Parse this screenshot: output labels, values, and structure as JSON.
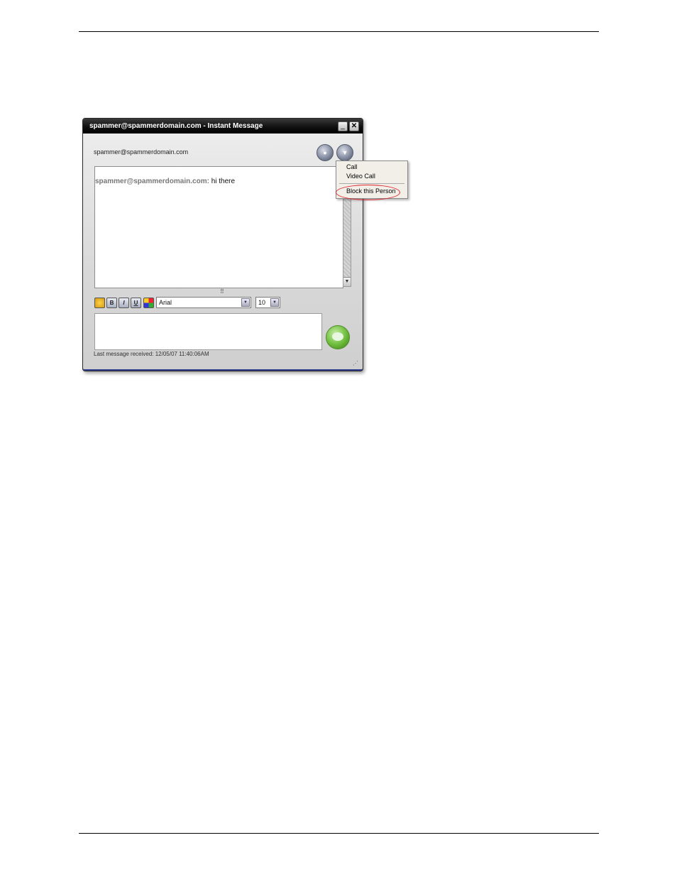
{
  "window": {
    "title": "spammer@spammerdomain.com - Instant Message",
    "minimize_glyph": "_",
    "close_glyph": "✕"
  },
  "header": {
    "contact": "spammer@spammerdomain.com",
    "contact_button_icon": "contact-icon",
    "menu_button_icon": "chevron-down-icon"
  },
  "chat": {
    "sender": "spammer@spammerdomain.com:",
    "message": " hi there"
  },
  "toolbar": {
    "bold_label": "B",
    "italic_label": "I",
    "underline_label": "U",
    "font": "Arial",
    "size": "10"
  },
  "status": {
    "text": "Last message received: 12/05/07 11:40:06AM"
  },
  "popup_menu": {
    "items": [
      "Call",
      "Video Call",
      "Block this Person"
    ],
    "highlight_color": "#e0202a"
  }
}
